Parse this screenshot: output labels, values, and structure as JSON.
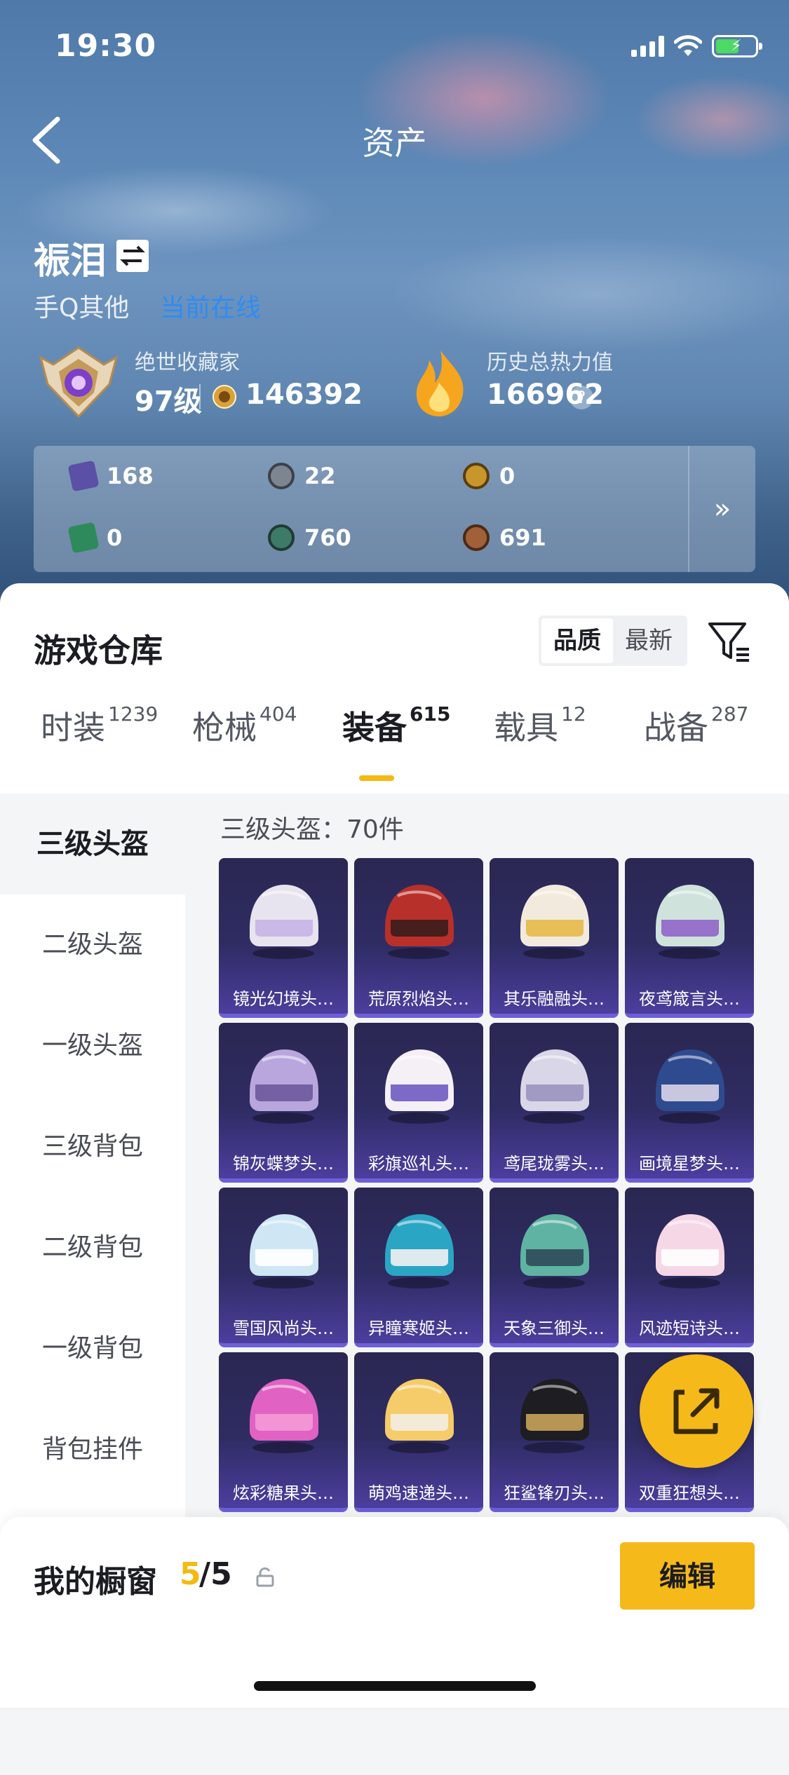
{
  "status_bar": {
    "time": "19:30"
  },
  "nav": {
    "title": "资产"
  },
  "user": {
    "name": "裖泪",
    "source": "手Q其他",
    "status": "当前在线"
  },
  "collector": {
    "title": "绝世收藏家",
    "level": "97级",
    "points": "146392"
  },
  "heat": {
    "title": "历史总热力值",
    "value": "166962",
    "help": "?"
  },
  "resources": [
    {
      "icon": "card-icon",
      "value": "168",
      "color": "#5b4fa6"
    },
    {
      "icon": "silver-coin-icon",
      "value": "22",
      "color": "#7d8590"
    },
    {
      "icon": "gold-badge-icon",
      "value": "0",
      "color": "#c9962b"
    },
    {
      "icon": "green-card-icon",
      "value": "0",
      "color": "#2e8a5a"
    },
    {
      "icon": "jade-coin-icon",
      "value": "760",
      "color": "#3d7a68"
    },
    {
      "icon": "bronze-coin-icon",
      "value": "691",
      "color": "#a0603a"
    }
  ],
  "resources_more": "»",
  "warehouse": {
    "title": "游戏仓库",
    "sort_options": [
      "品质",
      "最新"
    ],
    "sort_active": 0
  },
  "tabs": [
    {
      "label": "时装",
      "count": "1239"
    },
    {
      "label": "枪械",
      "count": "404"
    },
    {
      "label": "装备",
      "count": "615"
    },
    {
      "label": "载具",
      "count": "12"
    },
    {
      "label": "战备",
      "count": "287"
    }
  ],
  "active_tab": 2,
  "sidebar": [
    "三级头盔",
    "二级头盔",
    "一级头盔",
    "三级背包",
    "二级背包",
    "一级背包",
    "背包挂件"
  ],
  "grid_title": "三级头盔：70件",
  "items": [
    {
      "name": "镜光幻境头…",
      "color": "#e8e4ef",
      "accent": "#c7b3e6"
    },
    {
      "name": "荒原烈焰头…",
      "color": "#b8302a",
      "accent": "#3a1d1b"
    },
    {
      "name": "其乐融融头…",
      "color": "#f2ebdd",
      "accent": "#e7b94a"
    },
    {
      "name": "夜鸢箴言头…",
      "color": "#cfe3dc",
      "accent": "#8f65c9"
    },
    {
      "name": "锦灰蝶梦头…",
      "color": "#b9a6dc",
      "accent": "#6c5a9c"
    },
    {
      "name": "彩旗巡礼头…",
      "color": "#f4f0f6",
      "accent": "#6f5bc3"
    },
    {
      "name": "鸢尾珑雾头…",
      "color": "#d9d6e8",
      "accent": "#9a93bf"
    },
    {
      "name": "画境星梦头…",
      "color": "#2e4b8f",
      "accent": "#d9d5e8"
    },
    {
      "name": "雪国风尚头…",
      "color": "#cfe6f5",
      "accent": "#ffffff"
    },
    {
      "name": "异瞳寒姬头…",
      "color": "#2aa6c4",
      "accent": "#f2f2f2"
    },
    {
      "name": "天象三御头…",
      "color": "#5fb3a2",
      "accent": "#2f4a5a"
    },
    {
      "name": "风迹短诗头…",
      "color": "#f6d7e6",
      "accent": "#ffffff"
    },
    {
      "name": "炫彩糖果头…",
      "color": "#e062c3",
      "accent": "#f59ad6"
    },
    {
      "name": "萌鸡速递头…",
      "color": "#f5cc69",
      "accent": "#f3eee3"
    },
    {
      "name": "狂鲨锋刃头…",
      "color": "#1d1d22",
      "accent": "#c9a35a"
    },
    {
      "name": "双重狂想头…",
      "color": "#2d2a5a",
      "accent": "#4b3e9e"
    }
  ],
  "showcase": {
    "label": "我的橱窗",
    "count": "5",
    "total": "/5",
    "edit_label": "编辑"
  },
  "colors": {
    "accent": "#f6b91a",
    "link": "#2f8cf2",
    "tile_bg": "#2f2c63"
  }
}
